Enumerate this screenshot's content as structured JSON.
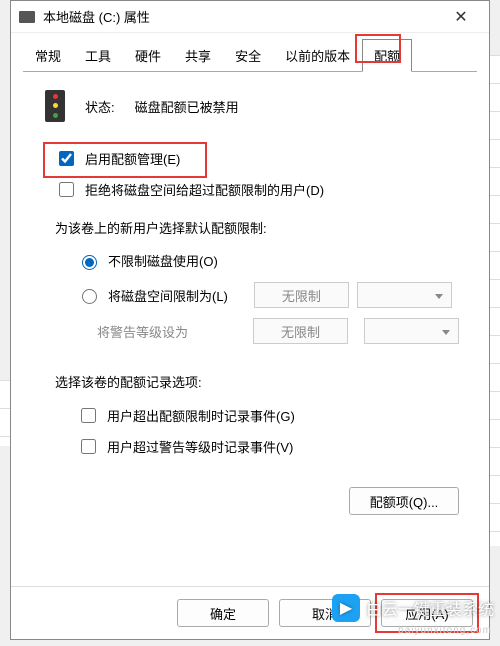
{
  "window": {
    "title": "本地磁盘 (C:) 属性",
    "close": "✕"
  },
  "tabs": [
    "常规",
    "工具",
    "硬件",
    "共享",
    "安全",
    "以前的版本",
    "配额"
  ],
  "active_tab_index": 6,
  "status": {
    "label": "状态:",
    "text": "磁盘配额已被禁用"
  },
  "checks": {
    "enable": "启用配额管理(E)",
    "deny": "拒绝将磁盘空间给超过配额限制的用户(D)"
  },
  "default_limit_label": "为该卷上的新用户选择默认配额限制:",
  "radios": {
    "nolimit": "不限制磁盘使用(O)",
    "limitto": "将磁盘空间限制为(L)"
  },
  "limit_rows": {
    "warn_label": "将警告等级设为",
    "nolimit_value": "无限制"
  },
  "log_label": "选择该卷的配额记录选项:",
  "log_checks": {
    "over_quota": "用户超出配额限制时记录事件(G)",
    "over_warn": "用户超过警告等级时记录事件(V)"
  },
  "quota_entries_btn": "配额项(Q)...",
  "footer": {
    "ok": "确定",
    "cancel": "取消",
    "apply": "应用(A)"
  },
  "watermark": {
    "brand": "白云一键重装系统",
    "url": "baiyunxitong.com",
    "bird": "▶"
  }
}
